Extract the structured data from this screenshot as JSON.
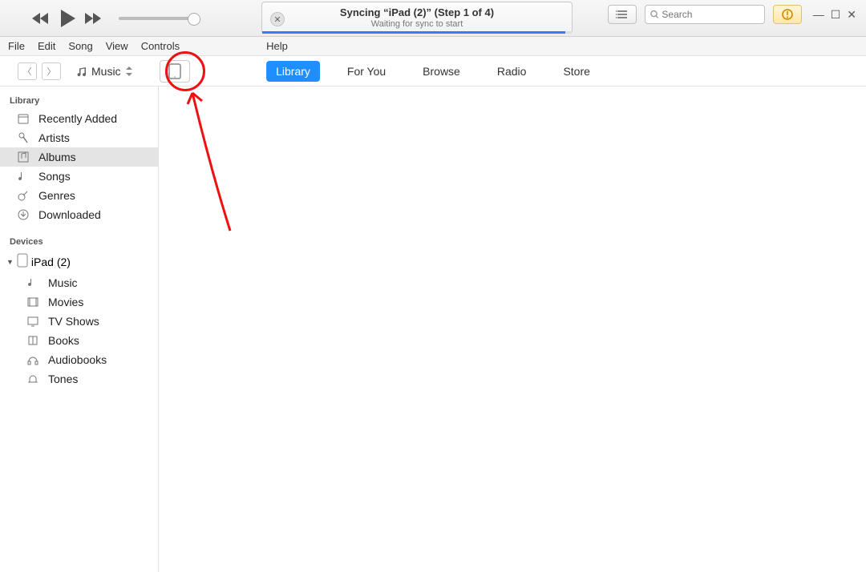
{
  "lcd": {
    "title": "Syncing “iPad (2)” (Step 1 of 4)",
    "subtitle": "Waiting for sync to start"
  },
  "search": {
    "placeholder": "Search"
  },
  "menu": {
    "file": "File",
    "edit": "Edit",
    "song": "Song",
    "view": "View",
    "controls": "Controls",
    "help": "Help"
  },
  "nav": {
    "selector_label": "Music",
    "tabs": {
      "library": "Library",
      "for_you": "For You",
      "browse": "Browse",
      "radio": "Radio",
      "store": "Store"
    }
  },
  "sidebar": {
    "library_header": "Library",
    "library_items": {
      "recently_added": "Recently Added",
      "artists": "Artists",
      "albums": "Albums",
      "songs": "Songs",
      "genres": "Genres",
      "downloaded": "Downloaded"
    },
    "devices_header": "Devices",
    "device_name": "iPad (2)",
    "device_items": {
      "music": "Music",
      "movies": "Movies",
      "tv_shows": "TV Shows",
      "books": "Books",
      "audiobooks": "Audiobooks",
      "tones": "Tones"
    }
  }
}
